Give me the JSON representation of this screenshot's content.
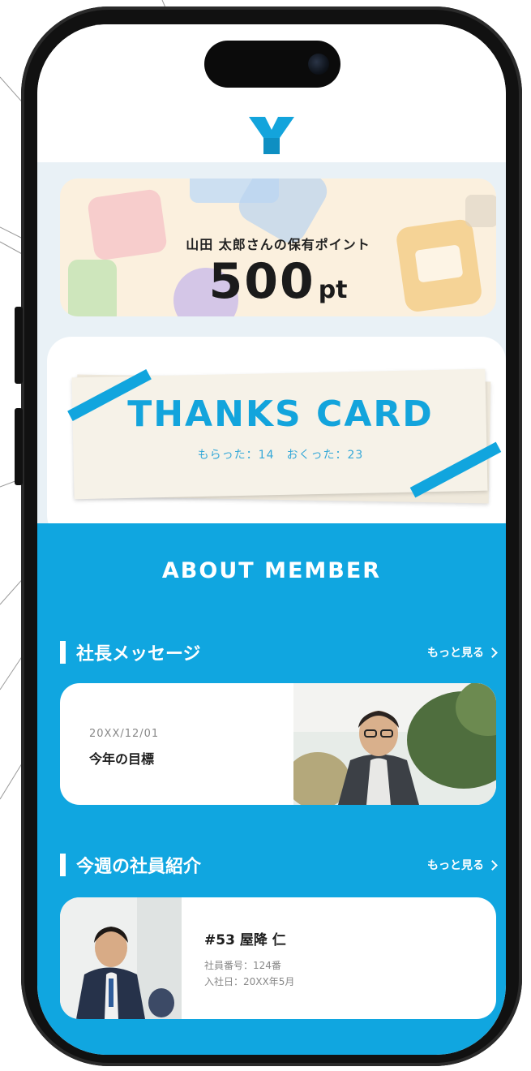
{
  "app": {
    "logo_letter": "Y",
    "accent": "#10a6e0"
  },
  "points": {
    "owner_label": "山田 太郎さんの保有ポイント",
    "value": "500",
    "unit": "pt"
  },
  "thanks_card": {
    "title": "THANKS CARD",
    "stats": "もらった：14　おくった：23"
  },
  "about": {
    "title": "ABOUT MEMBER"
  },
  "ceo_message": {
    "section_label": "社長メッセージ",
    "more_label": "もっと見る",
    "date": "20XX/12/01",
    "title": "今年の目標"
  },
  "weekly_member": {
    "section_label": "今週の社員紹介",
    "more_label": "もっと見る",
    "name": "#53 屋降 仁",
    "employee_no": "社員番号：124番",
    "joined": "入社日：20XX年5月"
  }
}
